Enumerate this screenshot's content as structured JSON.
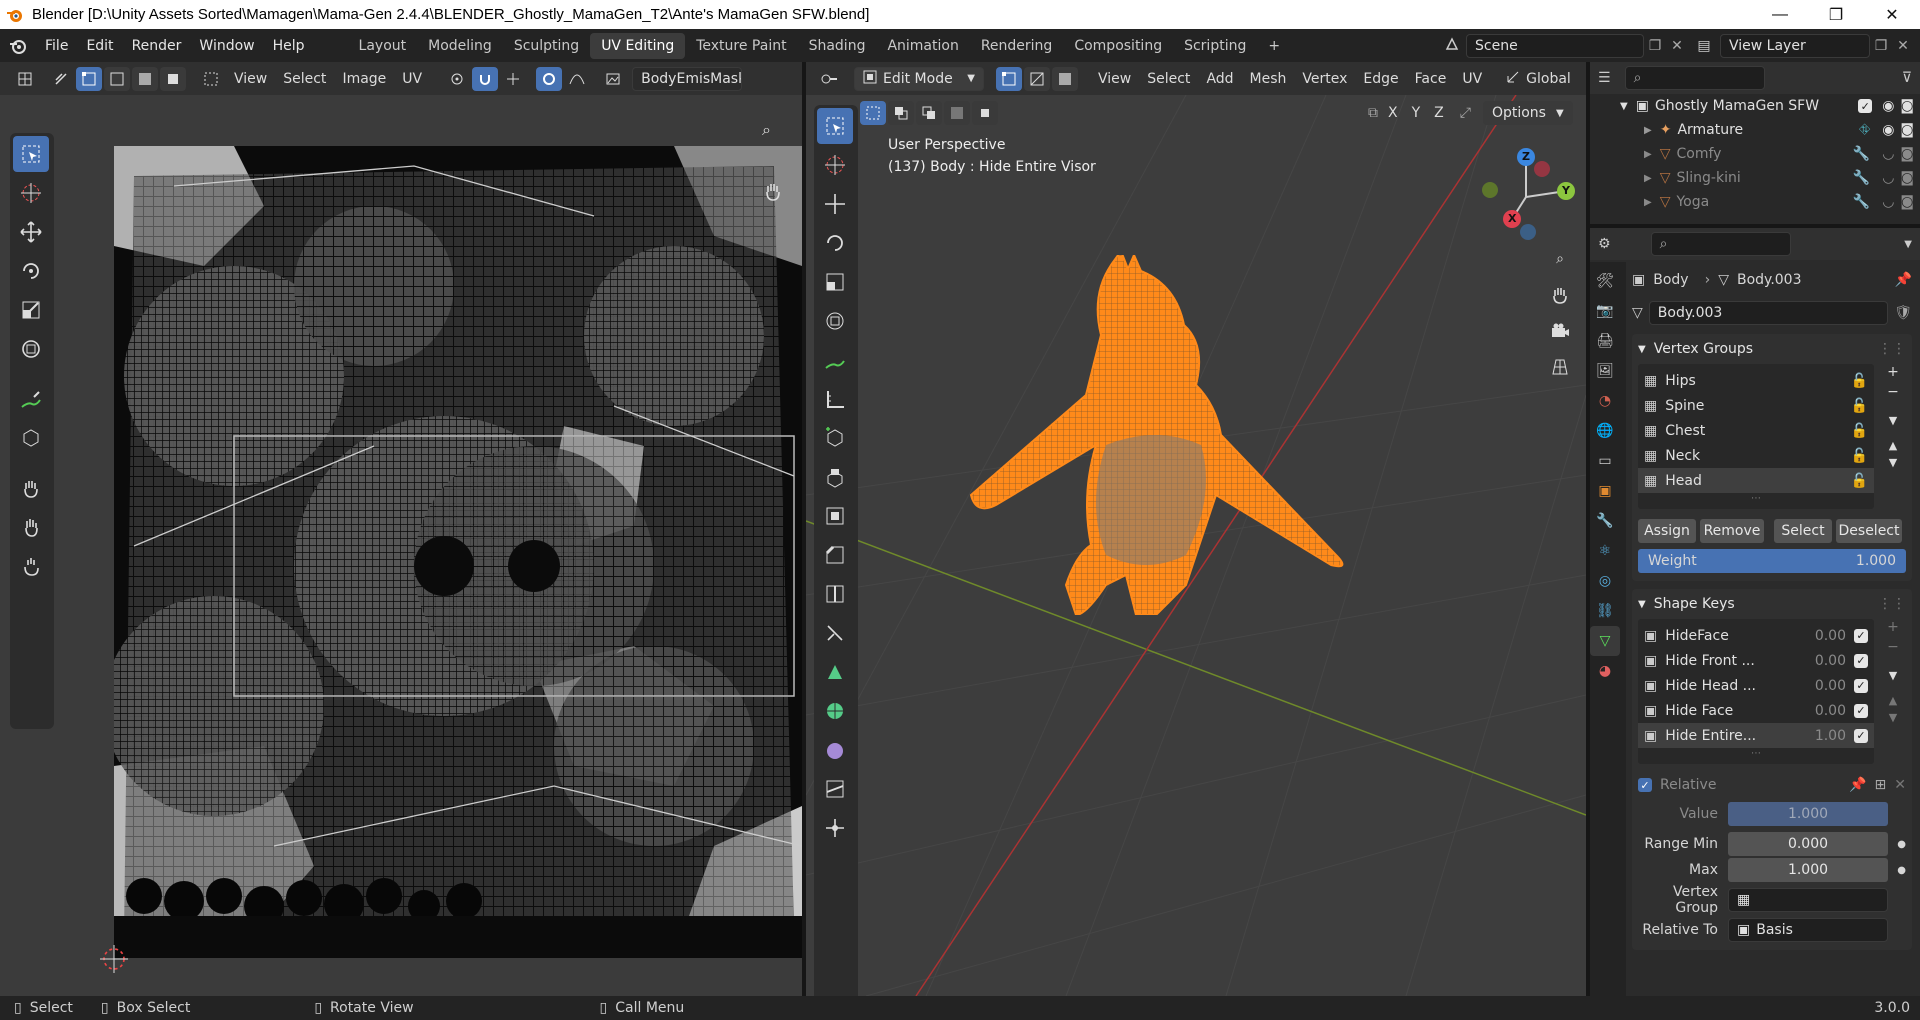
{
  "window": {
    "title": "Blender [D:\\Unity Assets Sorted\\Mamagen\\Mama-Gen 2.4.4\\BLENDER_Ghostly_MamaGen_T2\\Ante's MamaGen SFW.blend]",
    "minimize": "—",
    "maximize": "❐",
    "close": "✕"
  },
  "topbar": {
    "menus": [
      "File",
      "Edit",
      "Render",
      "Window",
      "Help"
    ],
    "workspaces": [
      "Layout",
      "Modeling",
      "Sculpting",
      "UV Editing",
      "Texture Paint",
      "Shading",
      "Animation",
      "Rendering",
      "Compositing",
      "Scripting"
    ],
    "active_workspace": "UV Editing",
    "add_workspace": "+",
    "scene": "Scene",
    "view_layer": "View Layer"
  },
  "uv_editor": {
    "menus": [
      "View",
      "Select",
      "Image",
      "UV"
    ],
    "image_name": "BodyEmisMask.p"
  },
  "viewport": {
    "mode": "Edit Mode",
    "menus": [
      "View",
      "Select",
      "Add",
      "Mesh",
      "Vertex",
      "Edge",
      "Face",
      "UV"
    ],
    "orientation": "Global",
    "axes": [
      "X",
      "Y",
      "Z"
    ],
    "options_label": "Options",
    "overlay_line1": "User Perspective",
    "overlay_line2": "(137) Body : Hide Entire Visor",
    "gizmo": {
      "x": "X",
      "y": "Y",
      "z": "Z"
    }
  },
  "outliner": {
    "collection": "Ghostly MamaGen SFW",
    "items": [
      {
        "label": "Armature",
        "dim": false
      },
      {
        "label": "Comfy",
        "dim": true
      },
      {
        "label": "Sling-kini",
        "dim": true
      },
      {
        "label": "Yoga",
        "dim": true
      }
    ]
  },
  "properties": {
    "breadcrumb_object": "Body",
    "breadcrumb_data": "Body.003",
    "mesh_name": "Body.003",
    "vertex_groups": {
      "title": "Vertex Groups",
      "items": [
        "Hips",
        "Spine",
        "Chest",
        "Neck",
        "Head"
      ],
      "selected": "Head",
      "buttons": [
        "Assign",
        "Remove",
        "Select",
        "Deselect"
      ],
      "weight_label": "Weight",
      "weight_value": "1.000"
    },
    "shape_keys": {
      "title": "Shape Keys",
      "items": [
        {
          "name": "HideFace",
          "value": "0.00"
        },
        {
          "name": "Hide Front ...",
          "value": "0.00"
        },
        {
          "name": "Hide Head ...",
          "value": "0.00"
        },
        {
          "name": "Hide Face",
          "value": "0.00"
        },
        {
          "name": "Hide Entire...",
          "value": "1.00"
        }
      ],
      "relative_label": "Relative",
      "value_label": "Value",
      "value": "1.000",
      "range_min_label": "Range Min",
      "range_min": "0.000",
      "max_label": "Max",
      "max": "1.000",
      "vertex_group_label": "Vertex Group",
      "relative_to_label": "Relative To",
      "relative_to": "Basis"
    }
  },
  "statusbar": {
    "items": [
      "Select",
      "Box Select",
      "Rotate View",
      "Call Menu"
    ],
    "version": "3.0.0"
  },
  "colors": {
    "accent": "#4772b3",
    "mesh_orange": "#ff8a1a",
    "header": "#303030"
  }
}
